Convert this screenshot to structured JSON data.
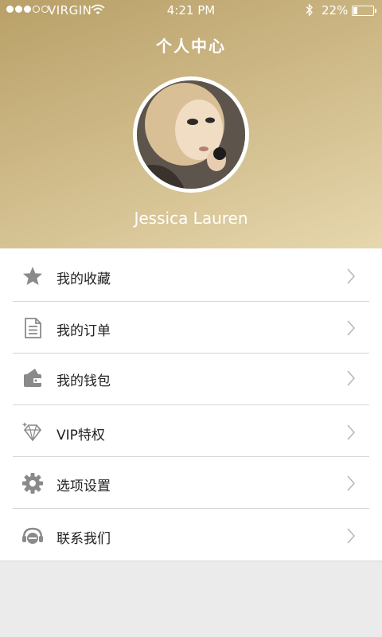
{
  "status_bar": {
    "carrier": "VIRGIN",
    "time": "4:21 PM",
    "battery_percent": "22%",
    "battery_level": 0.22,
    "signal_bars_filled": 3,
    "signal_bars_total": 5
  },
  "header": {
    "title": "个人中心",
    "user_name": "Jessica Lauren"
  },
  "menu": {
    "items": [
      {
        "label": "我的收藏",
        "icon": "star-icon"
      },
      {
        "label": "我的订单",
        "icon": "document-icon"
      },
      {
        "label": "我的钱包",
        "icon": "wallet-icon"
      },
      {
        "label": "VIP特权",
        "icon": "diamond-icon"
      },
      {
        "label": "选项设置",
        "icon": "gear-icon"
      },
      {
        "label": "联系我们",
        "icon": "headset-icon"
      }
    ]
  },
  "colors": {
    "header_gradient_start": "#b9a068",
    "header_gradient_end": "#e6d7ad",
    "icon_gray": "#8a8a8a",
    "chevron_gray": "#b8b8b8",
    "background": "#ebebeb"
  }
}
